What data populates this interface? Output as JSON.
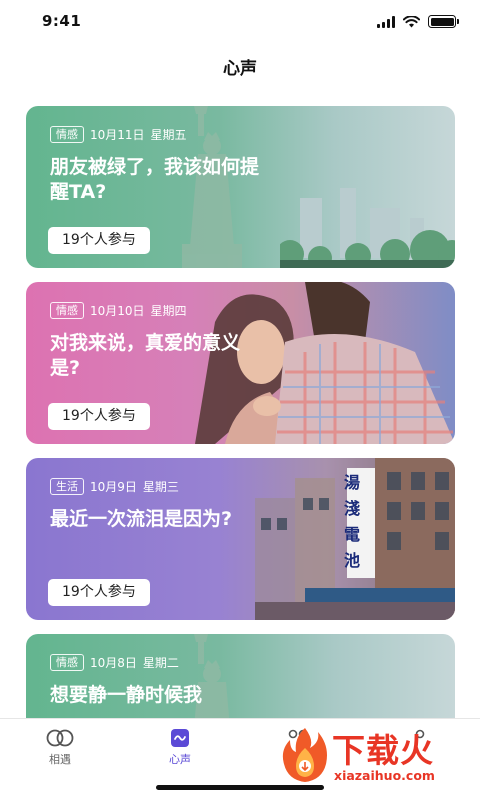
{
  "status_bar": {
    "time": "9:41",
    "signal_icon": "cellular-signal-icon",
    "wifi_icon": "wifi-icon",
    "battery_icon": "battery-icon"
  },
  "header": {
    "title": "心声"
  },
  "cards": [
    {
      "tag": "情感",
      "date": "10月11日",
      "weekday": "星期五",
      "title": "朋友被绿了，我该如何提醒TA?",
      "participants": "19个人参与",
      "theme": "green"
    },
    {
      "tag": "情感",
      "date": "10月10日",
      "weekday": "星期四",
      "title": "对我来说，真爱的意义是?",
      "participants": "19个人参与",
      "theme": "pink"
    },
    {
      "tag": "生活",
      "date": "10月9日",
      "weekday": "星期三",
      "title": "最近一次流泪是因为?",
      "participants": "19个人参与",
      "theme": "purple"
    },
    {
      "tag": "情感",
      "date": "10月8日",
      "weekday": "星期二",
      "title": "想要静一静时候我",
      "participants": "",
      "theme": "green"
    }
  ],
  "sign_text": "湯 淺 電 池",
  "tabs": [
    {
      "label": "相遇",
      "icon": "two-circles-icon",
      "active": false
    },
    {
      "label": "心声",
      "icon": "voice-wave-icon",
      "active": true
    },
    {
      "label": "",
      "icon": "people-icon",
      "active": false
    },
    {
      "label": "",
      "icon": "person-icon",
      "active": false
    }
  ],
  "watermark": {
    "title": "下载火",
    "url": "xiazaihuo.com"
  },
  "colors": {
    "accent": "#5b4ad6",
    "green_card": "#63b58f",
    "pink_card": "#dd72b1",
    "purple_card": "#8a76d0",
    "watermark": "#e83525"
  }
}
